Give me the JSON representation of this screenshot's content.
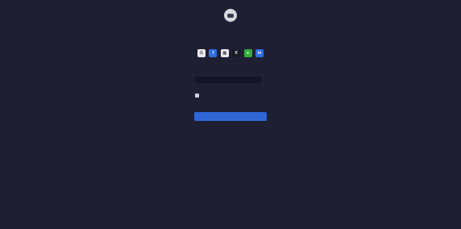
{
  "header": {
    "title": "",
    "subtitle": ""
  },
  "providers": [
    {
      "icon": "google-icon",
      "glyph": "G",
      "bg": "#e9e9ee",
      "fg": "#444"
    },
    {
      "icon": "facebook-icon",
      "glyph": "f",
      "bg": "#2f6fe0",
      "fg": "#ffffff"
    },
    {
      "icon": "microsoft-icon",
      "glyph": "▦",
      "bg": "#e9e9ee",
      "fg": "#555"
    },
    {
      "icon": "x-icon",
      "glyph": "X",
      "bg": "#1a1a26",
      "fg": "#ffffff"
    },
    {
      "icon": "wechat-icon",
      "glyph": "●",
      "bg": "#2fae3a",
      "fg": "#ffffff"
    },
    {
      "icon": "linkedin-icon",
      "glyph": "in",
      "bg": "#2f6fe0",
      "fg": "#ffffff"
    }
  ],
  "form": {
    "email_label": "",
    "email_value": "",
    "password_label": "",
    "checkbox_label": "",
    "remember_label": "",
    "submit_label": ""
  },
  "footer": {
    "signup_text": "",
    "signup_link": "",
    "help_link": ""
  },
  "colors": {
    "background": "#1f1f33",
    "accent": "#2f66d6"
  }
}
